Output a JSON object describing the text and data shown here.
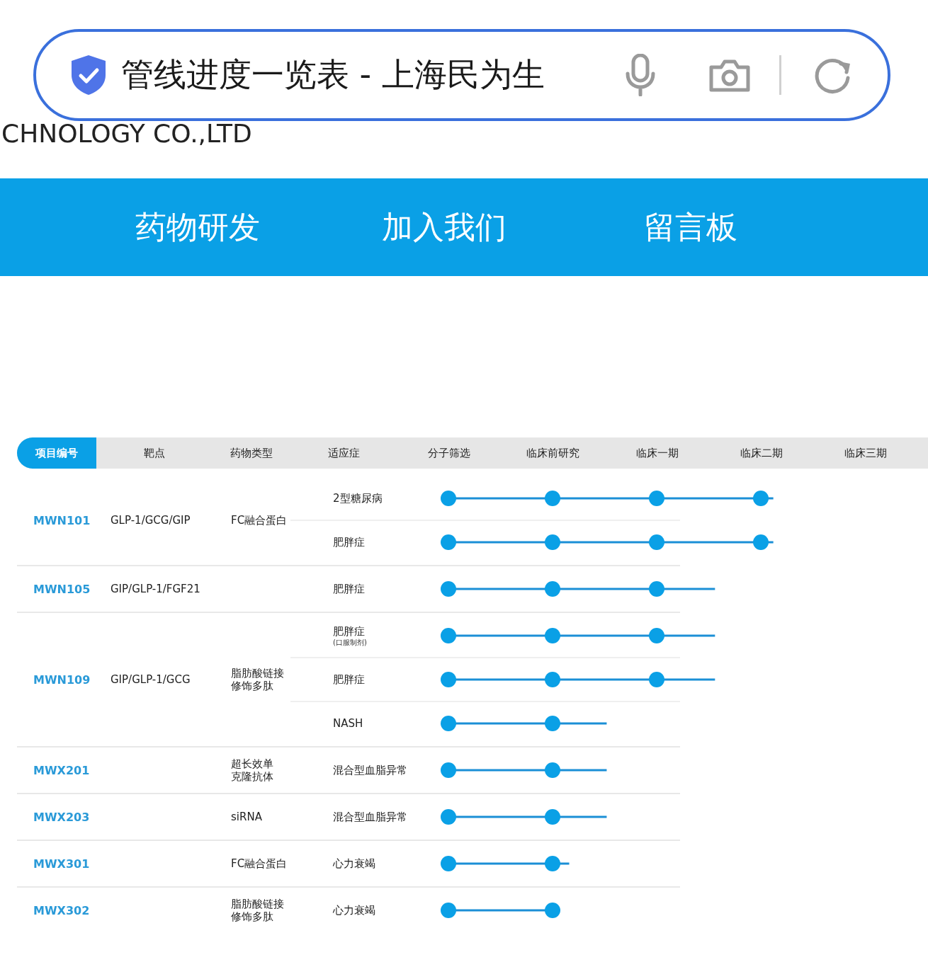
{
  "address_bar": {
    "title": "管线进度一览表 - 上海民为生"
  },
  "company_name": "CHNOLOGY CO.,LTD",
  "nav": [
    {
      "label": "药物研发"
    },
    {
      "label": "加入我们"
    },
    {
      "label": "留言板"
    }
  ],
  "table": {
    "columns": [
      {
        "label": "项目编号",
        "selected": true
      },
      {
        "label": "靶点",
        "selected": false
      },
      {
        "label": "药物类型",
        "selected": false
      },
      {
        "label": "适应症",
        "selected": false
      },
      {
        "label": "分子筛选",
        "selected": false
      },
      {
        "label": "临床前研究",
        "selected": false
      },
      {
        "label": "临床一期",
        "selected": false
      },
      {
        "label": "临床二期",
        "selected": false
      },
      {
        "label": "临床三期",
        "selected": false
      }
    ],
    "groups": [
      {
        "project": "MWN101",
        "target": "GLP-1/GCG/GIP",
        "drug_type": [
          "FC融合蛋白"
        ],
        "indications": [
          {
            "name": "2型糖尿病",
            "level": 0.78
          },
          {
            "name": "肥胖症",
            "level": 0.78
          }
        ]
      },
      {
        "project": "MWN105",
        "target": "GIP/GLP-1/FGF21",
        "indications": [
          {
            "name": "肥胖症",
            "level": 0.64
          }
        ]
      },
      {
        "project": "MWN109",
        "target": "GIP/GLP-1/GCG",
        "drug_type": [
          "脂肪酸链接",
          "修饰多肽"
        ],
        "indications": [
          {
            "name": "肥胖症",
            "note": "(口服制剂)",
            "level": 0.64
          },
          {
            "name": "肥胖症",
            "level": 0.64
          },
          {
            "name": "NASH",
            "level": 0.38
          }
        ]
      },
      {
        "project": "MWX201",
        "drug_type": [
          "超长效单",
          "克隆抗体"
        ],
        "indications": [
          {
            "name": "混合型血脂异常",
            "level": 0.38
          }
        ]
      },
      {
        "project": "MWX203",
        "drug_type": [
          "siRNA"
        ],
        "indications": [
          {
            "name": "混合型血脂异常",
            "level": 0.38
          }
        ]
      },
      {
        "project": "MWX301",
        "drug_type": [
          "FC融合蛋白"
        ],
        "indications": [
          {
            "name": "心力衰竭",
            "level": 0.29
          }
        ]
      },
      {
        "project": "MWX302",
        "drug_type": [
          "脂肪酸链接",
          "修饰多肽"
        ],
        "indications": [
          {
            "name": "心力衰竭",
            "level": 0.25
          }
        ]
      }
    ]
  }
}
